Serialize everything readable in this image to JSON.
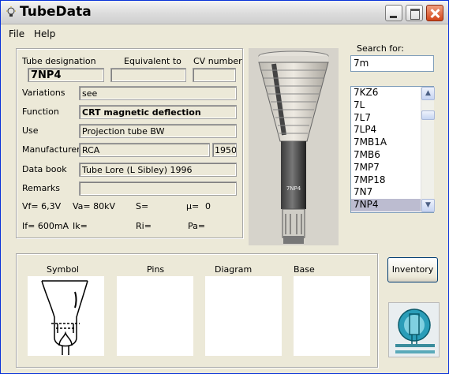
{
  "window": {
    "title": "TubeData"
  },
  "menu": {
    "file": "File",
    "help": "Help"
  },
  "form": {
    "tube_designation_label": "Tube designation",
    "equivalent_label": "Equivalent to",
    "cv_label": "CV number",
    "tube_designation": "7NP4",
    "equivalent": "",
    "cv_number": "",
    "variations_label": "Variations",
    "variations": "see",
    "function_label": "Function",
    "function": "CRT magnetic deflection",
    "use_label": "Use",
    "use": "Projection tube BW",
    "manufacturer_label": "Manufacturer",
    "manufacturer": "RCA",
    "year": "1950",
    "databook_label": "Data book",
    "databook": "Tube Lore (L Sibley) 1996",
    "remarks_label": "Remarks",
    "remarks": "",
    "vf": "Vf= 6,3V",
    "va": "Va= 80kV",
    "s": "S=",
    "mu": "µ=",
    "mu_value": "0",
    "if": "If= 600mA",
    "ik": "Ik=",
    "ri": "Ri=",
    "pa": "Pa="
  },
  "photo": {
    "tube_label": "7NP4"
  },
  "search": {
    "label": "Search for:",
    "value": "7m",
    "items": [
      "7KZ6",
      "7L",
      "7L7",
      "7LP4",
      "7MB1A",
      "7MB6",
      "7MP7",
      "7MP18",
      "7N7",
      "7NP4"
    ],
    "selected": "7NP4"
  },
  "bottom": {
    "symbol_label": "Symbol",
    "pins_label": "Pins",
    "diagram_label": "Diagram",
    "base_label": "Base"
  },
  "buttons": {
    "inventory": "Inventory"
  }
}
